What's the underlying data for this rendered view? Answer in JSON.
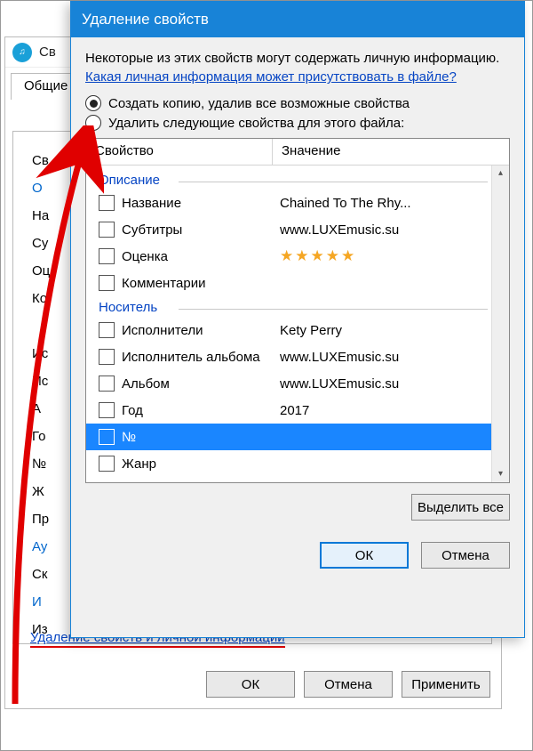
{
  "back": {
    "title": "Св",
    "tab_label": "Общие",
    "labels": [
      "Св",
      "О",
      "На",
      "Су",
      "Оц",
      "Ко",
      "",
      "Ис",
      "Ис",
      "А",
      "Го",
      "№",
      "Ж",
      "Пр",
      "Ау",
      "Ск",
      "И",
      "Из"
    ],
    "link": "Удаление свойств и личной информации",
    "buttons": {
      "ok": "ОК",
      "cancel": "Отмена",
      "apply": "Применить"
    }
  },
  "front": {
    "title": "Удаление свойств",
    "info": "Некоторые из этих свойств могут содержать личную информацию.",
    "info_link": "Какая личная информация может присутствовать в файле?",
    "radio1": "Создать копию, удалив все возможные свойства",
    "radio2": "Удалить следующие свойства для этого файла:",
    "headers": {
      "prop": "Свойство",
      "val": "Значение"
    },
    "groups": {
      "g1": "Описание",
      "g2": "Носитель"
    },
    "rows": {
      "r1p": "Название",
      "r1v": "Chained To The Rhy...",
      "r2p": "Субтитры",
      "r2v": "www.LUXEmusic.su",
      "r3p": "Оценка",
      "r3v": "★★★★★",
      "r4p": "Комментарии",
      "r4v": "",
      "r5p": "Исполнители",
      "r5v": "Kety Perry",
      "r6p": "Исполнитель альбома",
      "r6v": "www.LUXEmusic.su",
      "r7p": "Альбом",
      "r7v": "www.LUXEmusic.su",
      "r8p": "Год",
      "r8v": "2017",
      "r9p": "№",
      "r9v": "",
      "r10p": "Жанр",
      "r10v": ""
    },
    "select_all": "Выделить все",
    "buttons": {
      "ok": "ОК",
      "cancel": "Отмена"
    }
  }
}
